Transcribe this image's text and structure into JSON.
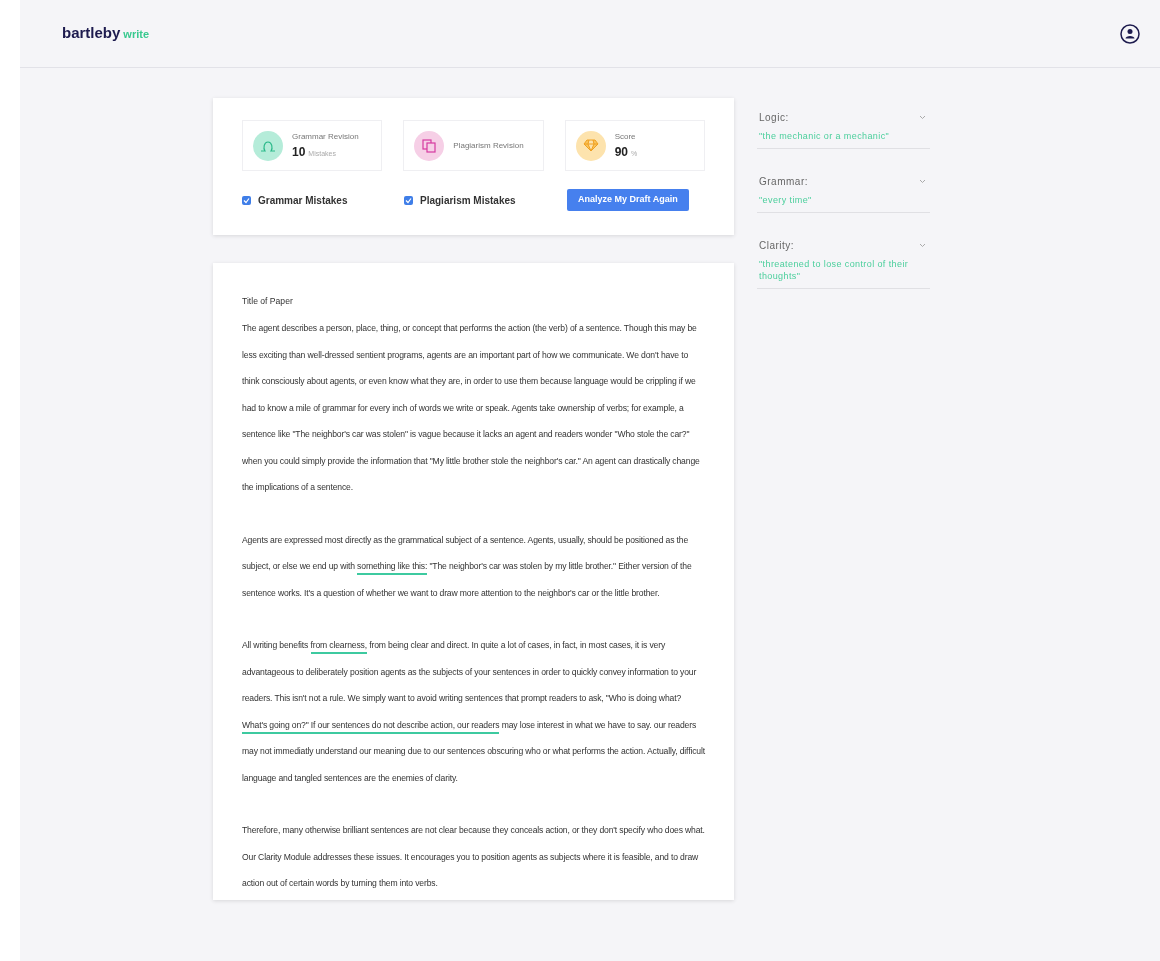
{
  "header": {
    "logo_main": "bartleby",
    "logo_accent": "write"
  },
  "stats": [
    {
      "kind": "grammar",
      "title": "Grammar Revision",
      "value": "10",
      "unit": "Mistakes"
    },
    {
      "kind": "plagiarism",
      "title": "Plagiarism Revision"
    },
    {
      "kind": "score",
      "title": "Score",
      "value": "90",
      "unit": "%"
    }
  ],
  "filters": [
    {
      "label": "Grammar Mistakes",
      "checked": true
    },
    {
      "label": "Plagiarism Mistakes",
      "checked": true
    }
  ],
  "analyze_button": "Analyze My Draft Again",
  "document": {
    "title": "Title of Paper",
    "paragraphs": [
      [
        {
          "text": "The agent describes a person, place, thing, or concept that performs the action (the verb) of a sentence. Though this may be less exciting than well-dressed sentient programs, agents are an important part of how we communicate. We don't have to think consciously about agents, or even know what they are, in order to use them because language would be crippling if we had to know a mile of grammar for every inch of words we write or speak. Agents take ownership of verbs; for example, a sentence like \"The neighbor's car was stolen\" is vague because it lacks an agent and readers wonder \"Who stole the car?\" when you could simply provide the information that \"My little brother stole the neighbor's car.\" An agent can drastically change the implications of a sentence.",
          "underlined": false
        }
      ],
      [
        {
          "text": "Agents are expressed most directly as the grammatical subject of a sentence. Agents, usually, should be positioned as the subject, or else we end up with ",
          "underlined": false
        },
        {
          "text": "something like this:",
          "underlined": true
        },
        {
          "text": " \"The neighbor's car was stolen by my little brother.\" Either version of the sentence works. It's a question of whether we want to draw more attention to the neighbor's car or the little brother.",
          "underlined": false
        }
      ],
      [
        {
          "text": "All writing benefits ",
          "underlined": false
        },
        {
          "text": "from clearness,",
          "underlined": true
        },
        {
          "text": " from being clear and direct. In quite a lot of cases, in fact, in most cases, it is very advantageous to deliberately position agents as the subjects of your sentences in order to quickly convey information to your readers. This isn't not a rule. We simply want to avoid writing sentences that prompt readers to ask, \"Who is doing what? ",
          "underlined": false
        },
        {
          "text": "What's going on?\" If our sentences do not describe action, our readers",
          "underlined": true
        },
        {
          "text": " may lose interest in what we have to say. our readers may not immediatly understand our meaning due to our sentences obscuring who or what performs the action. Actually, difficult language and tangled sentences are the enemies of clarity.",
          "underlined": false
        }
      ],
      [
        {
          "text": "Therefore, many otherwise brilliant sentences are not clear because they conceals action, or they don't specify who does what. Our Clarity Module addresses these issues. It encourages you to position agents as subjects where it is feasible, and to draw action out of certain words by turning them into verbs.",
          "underlined": false
        }
      ]
    ]
  },
  "suggestions": [
    {
      "label": "Logic:",
      "text": "\"the mechanic or a mechanic\"",
      "expanded": false
    },
    {
      "label": "Grammar:",
      "text": "\"every time\"",
      "expanded": false
    },
    {
      "label": "Clarity:",
      "text": "\"threatened to lose control of their thoughts\"",
      "expanded": false
    }
  ]
}
